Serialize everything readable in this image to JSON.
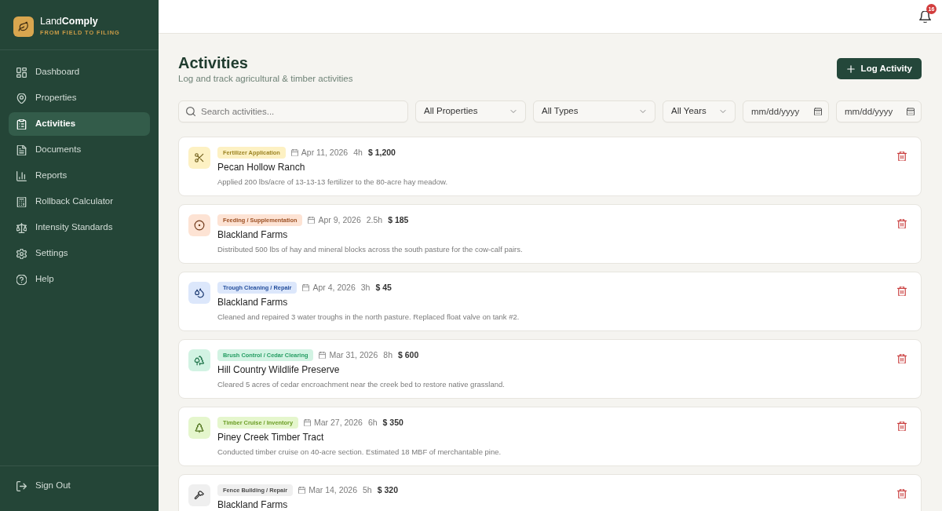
{
  "sidebar": {
    "brand": "Land**Comply**",
    "tagline": "FROM FIELD TO FILING",
    "items": [
      {
        "label": "Dashboard",
        "selected": false
      },
      {
        "label": "Properties",
        "selected": false
      },
      {
        "label": "Activities",
        "selected": true
      },
      {
        "label": "Documents",
        "selected": false
      },
      {
        "label": "Reports",
        "selected": false
      },
      {
        "label": "Rollback Calculator",
        "selected": false
      },
      {
        "label": "Intensity Standards",
        "selected": false
      },
      {
        "label": "Settings",
        "selected": false
      },
      {
        "label": "Help",
        "selected": false
      }
    ],
    "sign_out": "Sign Out"
  },
  "topbar": {
    "notification_count": "16"
  },
  "header": {
    "title": "Activities",
    "subtitle": "Log and track agricultural & timber activities",
    "action_button": "Log Activity"
  },
  "filters": {
    "search": {
      "placeholder": "Search activities..."
    },
    "dropdowns": [
      "All Properties",
      "All Types",
      "All Years"
    ],
    "date_fields": [
      {
        "placeholder": "mm/dd/yyyy"
      },
      {
        "placeholder": "mm/dd/yyyy"
      }
    ]
  },
  "activities": [
    {
      "kind": "fertilizer",
      "color": "#fdf1c3",
      "category": "Fertilizer Application",
      "date": "Apr 11, 2026",
      "hours": "4h",
      "amount": "$ 1,200",
      "property": "Pecan Hollow Ranch",
      "description": "Applied 200 lbs/acre of 13-13-13 fertilizer to the 80-acre hay meadow."
    },
    {
      "kind": "feeding",
      "color": "#fde3d4",
      "category": "Feeding / Supplementation",
      "date": "Apr 9, 2026",
      "hours": "2.5h",
      "amount": "$ 185",
      "property": "Blackland Farms",
      "description": "Distributed 500 lbs of hay and mineral blocks across the south pasture for the cow-calf pairs."
    },
    {
      "kind": "water",
      "color": "#dce7fb",
      "category": "Trough Cleaning / Repair",
      "date": "Apr 4, 2026",
      "hours": "3h",
      "amount": "$ 45",
      "property": "Blackland Farms",
      "description": "Cleaned and repaired 3 water troughs in the north pasture. Replaced float valve on tank #2."
    },
    {
      "kind": "brush",
      "color": "#d2f3e3",
      "category": "Brush Control / Cedar Clearing",
      "date": "Mar 31, 2026",
      "hours": "8h",
      "amount": "$ 600",
      "property": "Hill Country Wildlife Preserve",
      "description": "Cleared 5 acres of cedar encroachment near the creek bed to restore native grassland."
    },
    {
      "kind": "timber",
      "color": "#e5f6cd",
      "category": "Timber Cruise / Inventory",
      "date": "Mar 27, 2026",
      "hours": "6h",
      "amount": "$ 350",
      "property": "Piney Creek Timber Tract",
      "description": "Conducted timber cruise on 40-acre section. Estimated 18 MBF of merchantable pine."
    },
    {
      "kind": "fence",
      "color": "#efefef",
      "category": "Fence Building / Repair",
      "date": "Mar 14, 2026",
      "hours": "5h",
      "amount": "$ 320",
      "property": "Blackland Farms"
    }
  ]
}
